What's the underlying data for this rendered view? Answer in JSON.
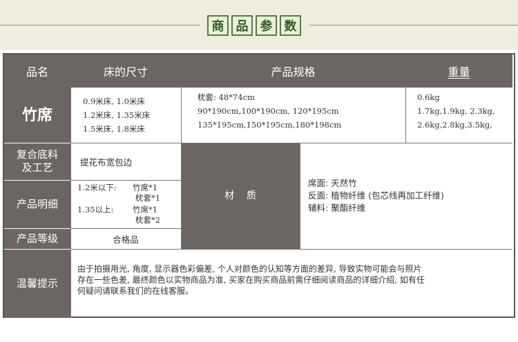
{
  "title": [
    "商",
    "品",
    "参",
    "数"
  ],
  "headers": {
    "name": "品名",
    "size": "床的尺寸",
    "spec": "产品规格",
    "weight": "重量"
  },
  "product": {
    "name": "竹席",
    "sizes": [
      "0.9米床, 1.0米床",
      "1.2米床, 1.35米床",
      "1.5米床, 1.8米床"
    ],
    "specs": [
      "枕套: 48*74cm",
      "90*190cm,100*190cm, 120*195cm",
      "135*195cm,150*195cm,180*198cm"
    ],
    "weights": [
      "0.6kg",
      "1.7kg,1.9kg, 2.3kg,",
      "2.6kg,2.8kg,3.5kg,"
    ]
  },
  "composite": {
    "label_line1": "复合底料",
    "label_line2": "及工艺",
    "value": "提花布宽包边"
  },
  "detail": {
    "label": "产品明细",
    "line1_left": "1.2米以下:",
    "line1_right": "竹席*1",
    "line2_right": "枕套*1",
    "line3_left": "1.35以上:",
    "line3_right": "竹席*1",
    "line4_right": "枕套*2"
  },
  "grade": {
    "label": "产品等级",
    "value": "合格品"
  },
  "material": {
    "label": "材    质",
    "lines": [
      "席面: 天然竹",
      "反面: 植物纤维 (包芯线再加工纤维)",
      "辅料: 聚酯纤维"
    ]
  },
  "notice": {
    "label": "温馨提示",
    "lines": [
      "由于拍摄用光, 角度, 显示器色彩偏差, 个人对颜色的认知等方面的差异, 导致实物可能会与照片",
      "存在一些色差, 最终颜色以实物商品为准, 买家在购买商品前需仔细阅读商品的详细介绍, 如有任",
      "何疑问请联系我们的在线客服。"
    ]
  },
  "colors": {
    "header_bg": "#6b6663",
    "banner_bg": "#efeddf",
    "title_green": "#2f5e27"
  }
}
